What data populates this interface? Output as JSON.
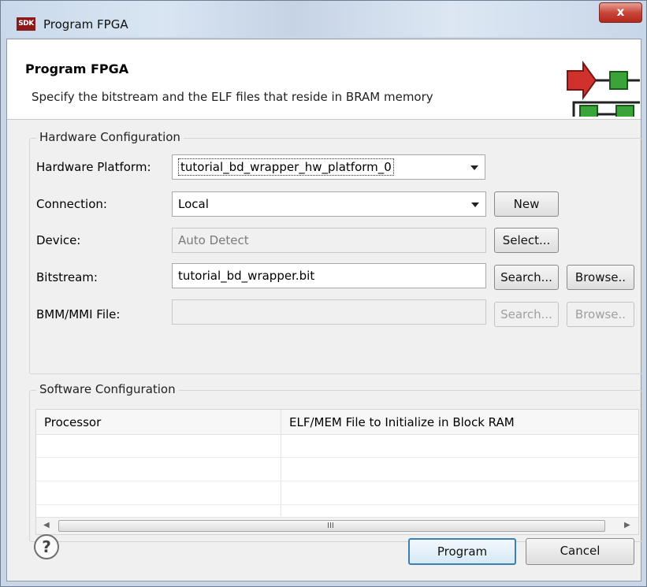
{
  "window": {
    "title": "Program FPGA",
    "icon_text": "SDK",
    "close_label": "x"
  },
  "header": {
    "title": "Program FPGA",
    "description": "Specify the bitstream and the ELF files that reside in BRAM memory",
    "image_icon": "wizard-graphic-icon"
  },
  "hardware": {
    "group_title": "Hardware Configuration",
    "platform_label": "Hardware Platform:",
    "platform_value": "tutorial_bd_wrapper_hw_platform_0",
    "connection_label": "Connection:",
    "connection_value": "Local",
    "new_button": "New",
    "device_label": "Device:",
    "device_value": "Auto Detect",
    "select_button": "Select...",
    "bitstream_label": "Bitstream:",
    "bitstream_value": "tutorial_bd_wrapper.bit",
    "bitstream_search": "Search...",
    "bitstream_browse": "Browse..",
    "bmm_label": "BMM/MMI File:",
    "bmm_value": "",
    "bmm_search": "Search...",
    "bmm_browse": "Browse.."
  },
  "software": {
    "group_title": "Software Configuration",
    "columns": [
      "Processor",
      "ELF/MEM File to Initialize in Block RAM"
    ],
    "scroll_grip": "III"
  },
  "footer": {
    "help_label": "?",
    "program_button": "Program",
    "cancel_button": "Cancel"
  },
  "colors": {
    "accent_red": "#d0312d",
    "accent_green": "#3aa33a",
    "default_button_border": "#3c7fb1"
  }
}
